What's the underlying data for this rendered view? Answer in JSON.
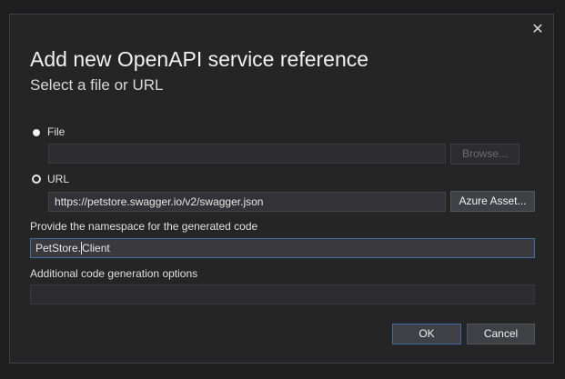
{
  "dialog": {
    "title": "Add new OpenAPI service reference",
    "subtitle": "Select a file or URL",
    "close_glyph": "✕"
  },
  "file_option": {
    "label": "File",
    "selected": false,
    "path_value": "",
    "browse_label": "Browse..."
  },
  "url_option": {
    "label": "URL",
    "selected": true,
    "url_value": "https://petstore.swagger.io/v2/swagger.json",
    "azure_label": "Azure Asset..."
  },
  "namespace": {
    "label": "Provide the namespace for the generated code",
    "value_before_caret": "PetStore.",
    "value_after_caret": "Client"
  },
  "options": {
    "label": "Additional code generation options",
    "value": ""
  },
  "footer": {
    "ok_label": "OK",
    "cancel_label": "Cancel"
  },
  "colors": {
    "background": "#252526",
    "accent_border": "#3d6ea8"
  }
}
